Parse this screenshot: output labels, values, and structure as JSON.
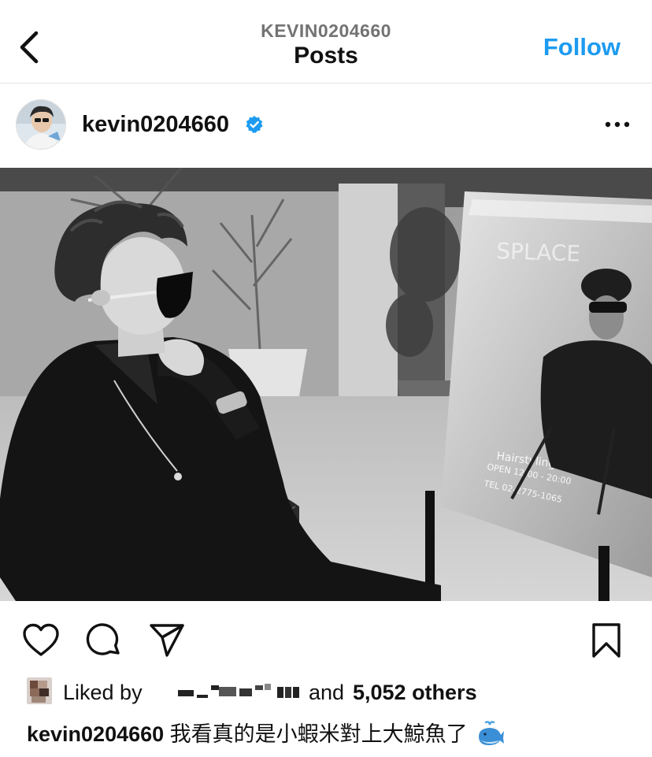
{
  "header": {
    "account_caption": "KEVIN0204660",
    "title": "Posts",
    "follow_label": "Follow"
  },
  "post": {
    "username": "kevin0204660",
    "verified": true,
    "photo": {
      "sign_brand": "SPLACE",
      "sign_service": "Hairstyling",
      "sign_hours": "OPEN 12:00 - 20:00",
      "sign_phone": "TEL 02-2775-1065"
    }
  },
  "likes": {
    "liked_by_label": "Liked by",
    "and_label": "and",
    "others_label": "5,052 others"
  },
  "caption": {
    "username": "kevin0204660",
    "text": "我看真的是小蝦米對上大鯨魚了"
  },
  "icons": {
    "back": "chevron-left-icon",
    "more": "more-horizontal-icon",
    "like": "heart-icon",
    "comment": "comment-icon",
    "share": "send-icon",
    "save": "bookmark-icon",
    "verified": "verified-badge-icon",
    "emoji": "whale-emoji-icon"
  },
  "colors": {
    "follow": "#1d9bf0",
    "verified": "#1d9bf0",
    "subtle_text": "#737373"
  }
}
